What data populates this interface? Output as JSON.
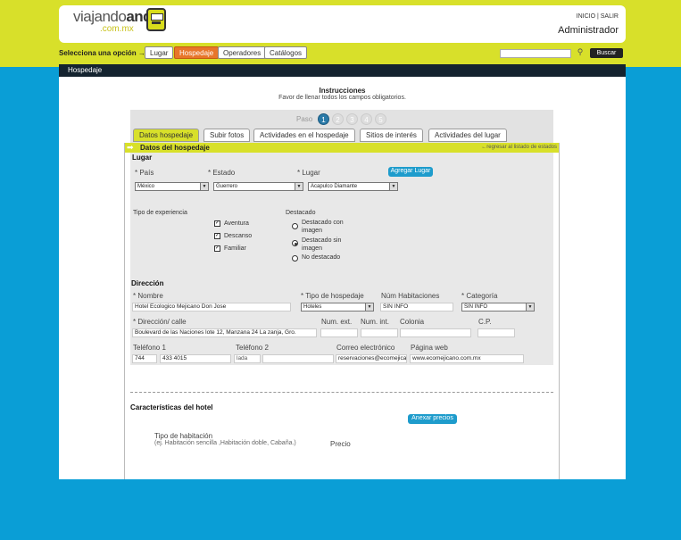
{
  "logo": {
    "line1a": "viajando",
    "line1b": "ando",
    "line2": ".com.mx"
  },
  "header": {
    "links": "INICIO | SALIR",
    "user": "Administrador"
  },
  "nav": {
    "prompt": "Selecciona una opción →",
    "items": [
      {
        "label": "Lugar"
      },
      {
        "label": "Hospedaje"
      },
      {
        "label": "Operadores"
      },
      {
        "label": "Catálogos"
      }
    ],
    "search_button": "Buscar",
    "search_value": ""
  },
  "page": {
    "title": "Hospedaje",
    "instructions_title": "Instrucciones",
    "instructions_text": "Favor de llenar todos los campos obligatorios."
  },
  "steps": {
    "label": "Paso",
    "numbers": [
      "1",
      "2",
      "3",
      "4",
      "5"
    ],
    "current": "1"
  },
  "tabs": [
    {
      "label": "Datos hospedaje"
    },
    {
      "label": "Subir fotos"
    },
    {
      "label": "Actividades en el hospedaje"
    },
    {
      "label": "Sitios de interés"
    },
    {
      "label": "Actividades del lugar"
    }
  ],
  "section": {
    "title": "Datos del hospedaje",
    "back": "←regresar al listado de estados"
  },
  "lugar": {
    "title": "Lugar",
    "pais_label": "* País",
    "pais_value": "México",
    "estado_label": "* Estado",
    "estado_value": "Guerrero",
    "lugar_label": "* Lugar",
    "lugar_value": "Acapulco Diamante",
    "add_button": "Agregar Lugar"
  },
  "experiencia": {
    "label": "Tipo de experiencia",
    "options": [
      "Aventura",
      "Descanso",
      "Familiar"
    ]
  },
  "destacado": {
    "label": "Destacado",
    "options": [
      "Destacado con imagen",
      "Destacado sin imagen",
      "No destacado"
    ],
    "selected": "Destacado sin imagen"
  },
  "direccion": {
    "title": "Dirección",
    "nombre_label": "* Nombre",
    "nombre_value": "Hotel Ecologico Mejicano Don Jose",
    "tipo_label": "* Tipo de hospedaje",
    "tipo_value": "Hoteles",
    "habitaciones_label": "Núm Habitaciones",
    "habitaciones_value": "SIN INFO",
    "categoria_label": "* Categoría",
    "categoria_value": "SIN INFO",
    "calle_label": "* Dirección/ calle",
    "calle_value": "Boulevard de las Naciones lote 12, Manzana 24 La zanja, Gro.",
    "ext_label": "Num. ext.",
    "int_label": "Num. int.",
    "colonia_label": "Colonia",
    "cp_label": "C.P.",
    "tel1_label": "Teléfono 1",
    "tel1_lada": "744",
    "tel1_num": "433 4015",
    "tel2_label": "Teléfono 2",
    "tel2_lada": "lada",
    "correo_label": "Correo electrónico",
    "correo_value": "reservaciones@ecomejicano",
    "web_label": "Página web",
    "web_value": "www.ecomejicano.com.mx"
  },
  "caracteristicas": {
    "title": "Características del hotel",
    "anexar_button": "Anexar precios",
    "tipo_label": "Tipo de habitación",
    "tipo_hint": "(ej. Habitación sencilla ,Habitación doble, Cabaña.)",
    "precio_label": "Precio"
  }
}
